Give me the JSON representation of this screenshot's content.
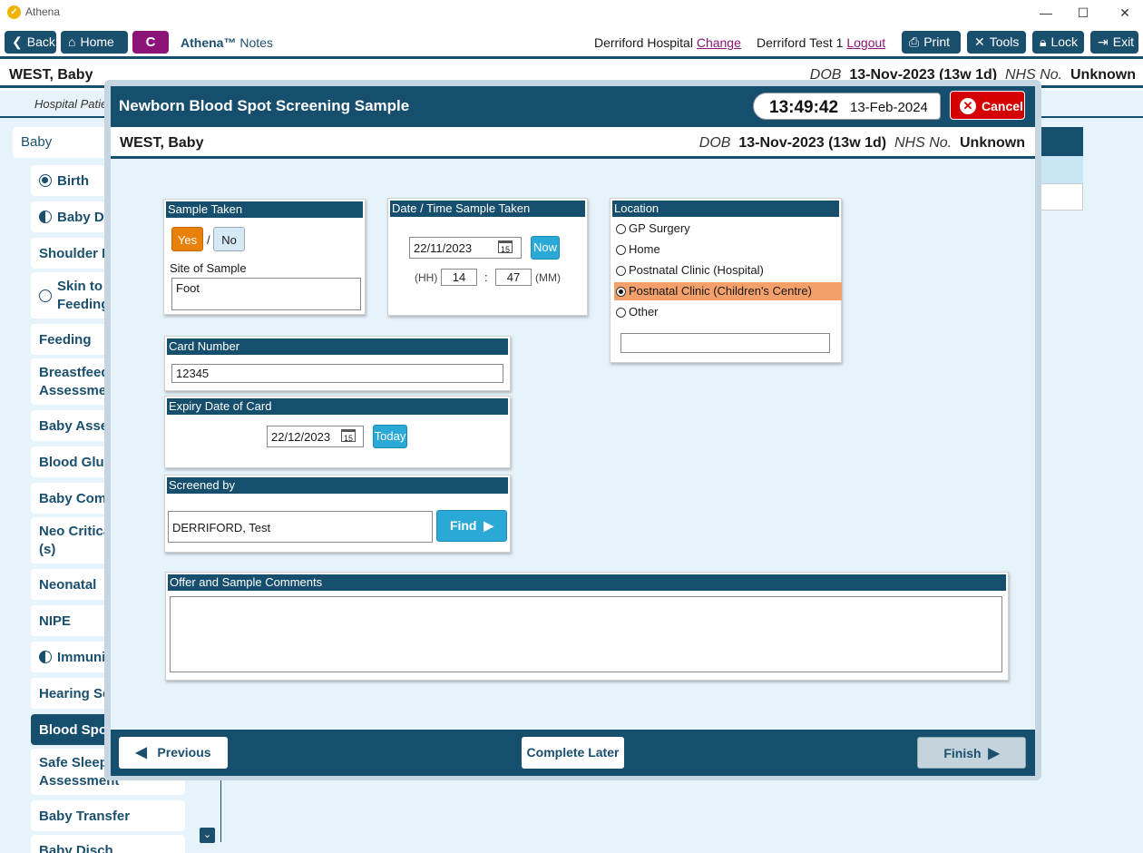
{
  "app": {
    "title": "Athena"
  },
  "toolbar": {
    "back": "Back",
    "home": "Home",
    "c_label": "C",
    "brand": "Athena™",
    "brand_suffix": "Notes",
    "hospital": "Derriford Hospital",
    "change": "Change",
    "user": "Derriford Test 1",
    "logout": "Logout",
    "print": "Print",
    "tools": "Tools",
    "lock": "Lock",
    "exit": "Exit"
  },
  "patient": {
    "name": "WEST, Baby",
    "dob_label": "DOB",
    "dob": "13-Nov-2023 (13w 1d)",
    "nhs_label": "NHS No.",
    "nhs": "Unknown"
  },
  "background": {
    "hospital_patient": "Hospital Patie",
    "sidebar_head": "Baby",
    "items": [
      {
        "label": "Birth",
        "icon": "radio-full"
      },
      {
        "label": "Baby Dev",
        "icon": "radio-half"
      },
      {
        "label": "Shoulder D",
        "icon": "none"
      },
      {
        "label": "Skin to S",
        "label2": "Feeding",
        "icon": "radio-empty"
      },
      {
        "label": "Feeding",
        "icon": "none"
      },
      {
        "label": "Breastfeedi",
        "label2": "Assessmen",
        "icon": "none"
      },
      {
        "label": "Baby Asses",
        "icon": "none"
      },
      {
        "label": "Blood Gluc",
        "icon": "none"
      },
      {
        "label": "Baby Comr",
        "icon": "none"
      },
      {
        "label": "Neo Critica",
        "label2": "(s)",
        "icon": "none"
      },
      {
        "label": "Neonatal",
        "icon": "none"
      },
      {
        "label": "NIPE",
        "icon": "none"
      },
      {
        "label": "Immunis",
        "icon": "radio-half"
      },
      {
        "label": "Hearing Sc",
        "icon": "none"
      },
      {
        "label": "Blood Spot",
        "icon": "none",
        "active": true
      },
      {
        "label": "Safe Sleepi",
        "label2": "Assessment",
        "icon": "none"
      },
      {
        "label": "Baby Transfer",
        "icon": "none"
      },
      {
        "label": "Baby Disch",
        "icon": "none"
      }
    ]
  },
  "modal": {
    "title": "Newborn Blood Spot Screening Sample",
    "time": "13:49:42",
    "date": "13-Feb-2024",
    "cancel": "Cancel",
    "sample_taken": {
      "header": "Sample Taken",
      "yes": "Yes",
      "sep": "/",
      "no": "No",
      "site_label": "Site of Sample",
      "site_value": "Foot"
    },
    "datetime": {
      "header": "Date / Time Sample Taken",
      "date": "22/11/2023",
      "cal_num": "15",
      "now": "Now",
      "hh_label": "(HH)",
      "hh": "14",
      "colon": ":",
      "mm": "47",
      "mm_label": "(MM)"
    },
    "location": {
      "header": "Location",
      "options": [
        "GP Surgery",
        "Home",
        "Postnatal Clinic (Hospital)",
        "Postnatal Clinic (Children's Centre)",
        "Other"
      ],
      "selected_index": 3,
      "other_value": ""
    },
    "card_number": {
      "header": "Card Number",
      "value": "12345"
    },
    "expiry": {
      "header": "Expiry Date of Card",
      "date": "22/12/2023",
      "cal_num": "15",
      "today": "Today"
    },
    "screened_by": {
      "header": "Screened by",
      "value": "DERRIFORD, Test",
      "find": "Find"
    },
    "comments": {
      "header": "Offer and Sample Comments",
      "value": ""
    },
    "footer": {
      "previous": "Previous",
      "complete_later": "Complete Later",
      "finish": "Finish"
    }
  },
  "colors": {
    "navy": "#164f6e",
    "magenta": "#8c1478",
    "accent_blue": "#2ba9d6",
    "cancel_red": "#d40000",
    "yes_orange": "#e8800a",
    "selected_orange": "#f4a06a"
  }
}
